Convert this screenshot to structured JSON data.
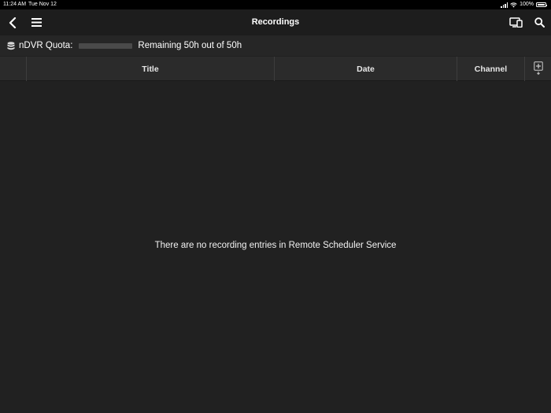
{
  "status_bar": {
    "time": "11:24 AM",
    "date": "Tue Nov 12",
    "battery_text": "100%",
    "icons": [
      "signal-icon",
      "wifi-icon",
      "battery-icon"
    ]
  },
  "nav": {
    "title": "Recordings",
    "icons": [
      "back-icon",
      "menu-icon",
      "devices-icon",
      "search-icon"
    ]
  },
  "quota": {
    "label": "nDVR Quota:",
    "remaining_text": "Remaining 50h out of 50h",
    "used_fraction": 0.0
  },
  "table": {
    "columns": [
      "Title",
      "Date",
      "Channel"
    ]
  },
  "empty_message": "There are no recording entries in Remote Scheduler Service",
  "colors": {
    "background": "#212121",
    "navbar": "#1d1d1d",
    "header": "#2b2b2b",
    "text": "#ffffff"
  }
}
